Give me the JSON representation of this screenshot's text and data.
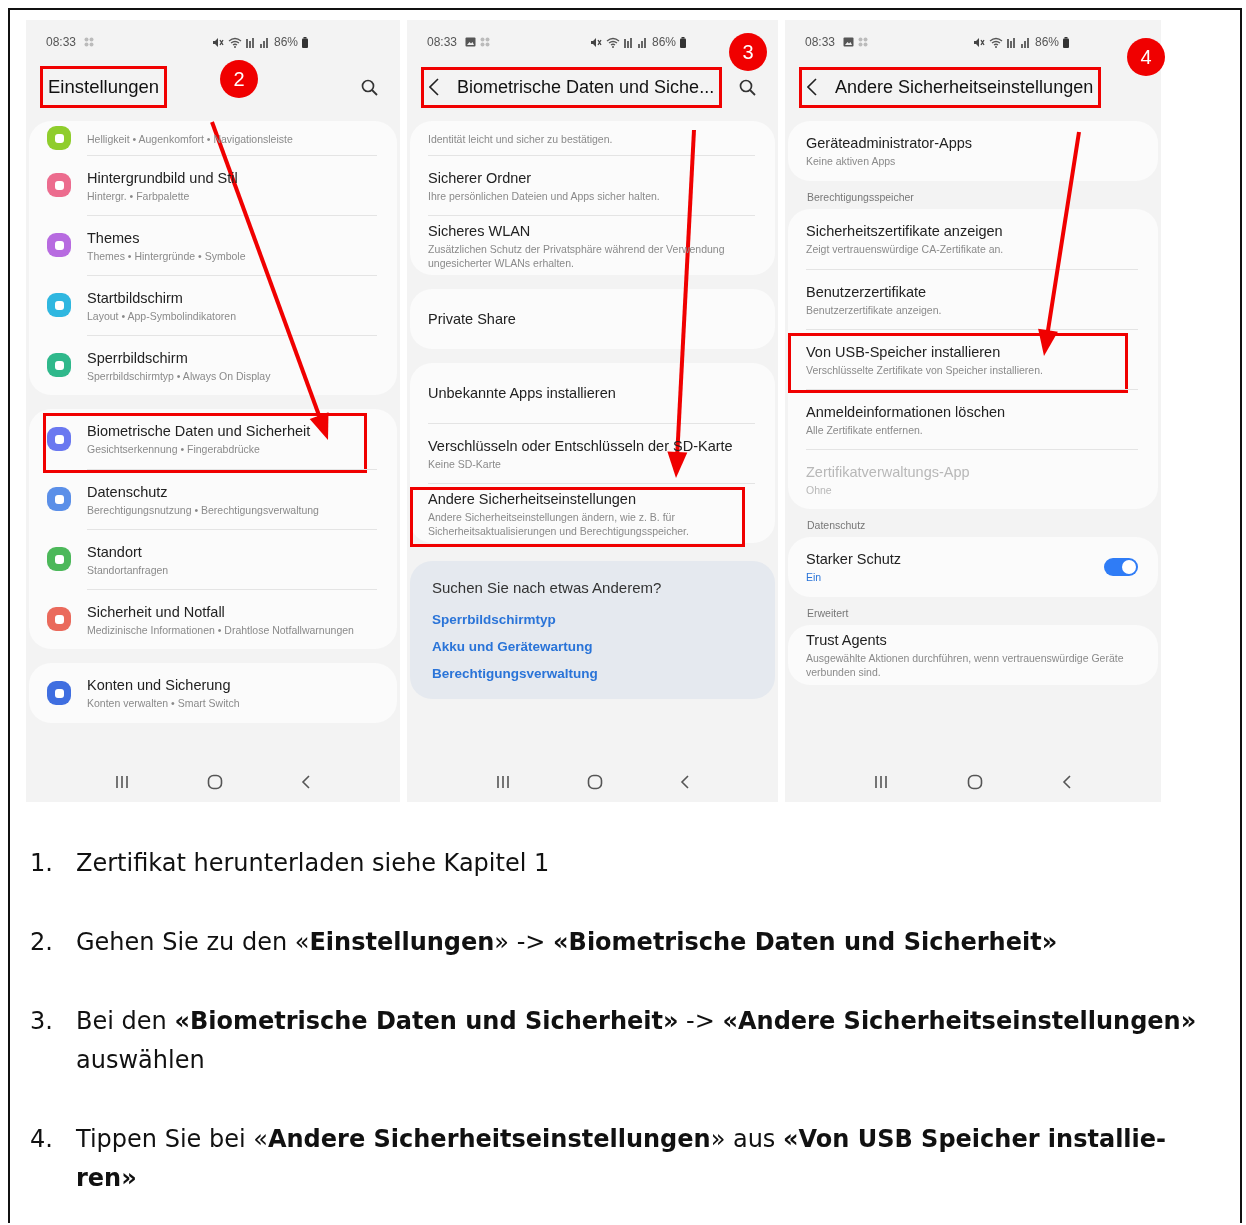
{
  "phones": [
    {
      "status": {
        "time": "08:33",
        "battery": "86%",
        "screenshot_icon": false
      },
      "header": {
        "kind": "large",
        "title": "Einstellungen",
        "search": true,
        "highlighted": true
      },
      "marker": "2",
      "blocks": [
        {
          "kind": "card",
          "rows": [
            {
              "kind": "text",
              "title": "",
              "subtitle": "Helligkeit • Augenkomfort • Navigationsleiste",
              "color": "#8fcd2c",
              "highlighted": false,
              "disabled": false
            },
            {
              "kind": "text",
              "title": "Hintergrundbild und Stil",
              "subtitle": "Hintergr. • Farbpalette",
              "color": "#ec6c8e",
              "highlighted": false,
              "disabled": false
            },
            {
              "kind": "text",
              "title": "Themes",
              "subtitle": "Themes • Hintergründe • Symbole",
              "color": "#b76be0",
              "highlighted": false,
              "disabled": false
            },
            {
              "kind": "text",
              "title": "Startbildschirm",
              "subtitle": "Layout • App-Symbolindikatoren",
              "color": "#2fb7e0",
              "highlighted": false,
              "disabled": false
            },
            {
              "kind": "text",
              "title": "Sperrbildschirm",
              "subtitle": "Sperrbildschirmtyp • Always On Display",
              "color": "#2fb88b",
              "highlighted": false,
              "disabled": false
            }
          ]
        },
        {
          "kind": "card",
          "rows": [
            {
              "kind": "text",
              "title": "Biometrische Daten und Sicherheit",
              "subtitle": "Gesichtserkennung • Fingerabdrücke",
              "color": "#6a78f0",
              "highlighted": true,
              "disabled": false
            },
            {
              "kind": "text",
              "title": "Datenschutz",
              "subtitle": "Berechtigungsnutzung • Berechtigungsverwaltung",
              "color": "#5b8fe8",
              "highlighted": false,
              "disabled": false
            },
            {
              "kind": "text",
              "title": "Standort",
              "subtitle": "Standortanfragen",
              "color": "#4cb85a",
              "highlighted": false,
              "disabled": false
            },
            {
              "kind": "text",
              "title": "Sicherheit und Notfall",
              "subtitle": "Medizinische Informationen • Drahtlose Notfallwarnungen",
              "color": "#ea6a5c",
              "highlighted": false,
              "disabled": false
            }
          ]
        },
        {
          "kind": "card",
          "rows": [
            {
              "kind": "text",
              "title": "Konten und Sicherung",
              "subtitle": "Konten verwalten • Smart Switch",
              "color": "#3f6ee0",
              "highlighted": false,
              "disabled": false
            }
          ]
        }
      ]
    },
    {
      "status": {
        "time": "08:33",
        "battery": "86%",
        "screenshot_icon": true
      },
      "header": {
        "kind": "back",
        "title": "Biometrische Daten und Siche...",
        "search": true,
        "highlighted": true
      },
      "marker": "3",
      "blocks": [
        {
          "kind": "card",
          "rows": [
            {
              "kind": "text",
              "title": "",
              "subtitle": "Identität leicht und sicher zu bestätigen.",
              "highlighted": false,
              "disabled": false
            },
            {
              "kind": "text",
              "title": "Sicherer Ordner",
              "subtitle": "Ihre persönlichen Dateien und Apps sicher halten.",
              "highlighted": false,
              "disabled": false
            },
            {
              "kind": "text",
              "title": "Sicheres WLAN",
              "subtitle": "Zusätzlichen Schutz der Privatsphäre während der Verwendung ungesicherter WLANs erhalten.",
              "highlighted": false,
              "disabled": false
            }
          ]
        },
        {
          "kind": "card",
          "rows": [
            {
              "kind": "text",
              "title": "Private Share",
              "subtitle": "",
              "highlighted": false,
              "disabled": false
            }
          ]
        },
        {
          "kind": "card",
          "rows": [
            {
              "kind": "text",
              "title": "Unbekannte Apps installieren",
              "subtitle": "",
              "highlighted": false,
              "disabled": false
            },
            {
              "kind": "text",
              "title": "Verschlüsseln oder Entschlüsseln der SD-Karte",
              "subtitle": "Keine SD-Karte",
              "highlighted": false,
              "disabled": false
            },
            {
              "kind": "text",
              "title": "Andere Sicherheitseinstellungen",
              "subtitle": "Andere Sicherheitseinstellungen ändern, wie z. B. für Sicherheitsaktualisierungen und Berechtigungsspeicher.",
              "highlighted": true,
              "disabled": false
            }
          ]
        },
        {
          "kind": "suggest",
          "title": "Suchen Sie nach etwas Anderem?",
          "links": [
            "Sperrbildschirmtyp",
            "Akku und Gerätewartung",
            "Berechtigungsverwaltung"
          ]
        }
      ]
    },
    {
      "status": {
        "time": "08:33",
        "battery": "86%",
        "screenshot_icon": true
      },
      "header": {
        "kind": "back",
        "title": "Andere Sicherheitseinstellungen",
        "search": false,
        "highlighted": true
      },
      "marker": "4",
      "blocks": [
        {
          "kind": "card",
          "rows": [
            {
              "kind": "text",
              "title": "Geräteadministrator-Apps",
              "subtitle": "Keine aktiven Apps",
              "highlighted": false,
              "disabled": false
            }
          ]
        },
        {
          "kind": "section",
          "label": "Berechtigungsspeicher"
        },
        {
          "kind": "card",
          "rows": [
            {
              "kind": "text",
              "title": "Sicherheitszertifikate anzeigen",
              "subtitle": "Zeigt vertrauenswürdige CA-Zertifikate an.",
              "highlighted": false,
              "disabled": false
            },
            {
              "kind": "text",
              "title": "Benutzerzertifikate",
              "subtitle": "Benutzerzertifikate anzeigen.",
              "highlighted": false,
              "disabled": false
            },
            {
              "kind": "text",
              "title": "Von USB-Speicher installieren",
              "subtitle": "Verschlüsselte Zertifikate von Speicher installieren.",
              "highlighted": true,
              "disabled": false
            },
            {
              "kind": "text",
              "title": "Anmeldeinformationen löschen",
              "subtitle": "Alle Zertifikate entfernen.",
              "highlighted": false,
              "disabled": false
            },
            {
              "kind": "text",
              "title": "Zertifikatverwaltungs-App",
              "subtitle": "Ohne",
              "highlighted": false,
              "disabled": true
            }
          ]
        },
        {
          "kind": "section",
          "label": "Datenschutz"
        },
        {
          "kind": "card",
          "rows": [
            {
              "kind": "switch",
              "title": "Starker Schutz",
              "subtitle": "Ein",
              "on": true,
              "highlighted": false,
              "disabled": false
            }
          ]
        },
        {
          "kind": "section",
          "label": "Erweitert"
        },
        {
          "kind": "card",
          "rows": [
            {
              "kind": "text",
              "title": "Trust Agents",
              "subtitle": "Ausgewählte Aktionen durchführen, wenn vertrauenswürdige Geräte verbunden sind.",
              "highlighted": false,
              "disabled": false
            }
          ]
        }
      ]
    }
  ],
  "steps": [
    {
      "number": "1.",
      "text": "Zertifikat herunterladen siehe Kapitel 1"
    },
    {
      "number": "2.",
      "text": "Gehen Sie zu den «**Einstellungen**» -> **«Biometrische Daten und Sicherheit»**"
    },
    {
      "number": "3.",
      "text": "Bei den **«Biometrische Daten und Sicherheit»** -> **«Andere Sicherheitseinstellungen»** auswählen"
    },
    {
      "number": "4.",
      "text": "Tippen Sie bei «**Andere Sicherheitseinstellungen**» aus **«Von USB Speicher installie-ren»**"
    }
  ]
}
